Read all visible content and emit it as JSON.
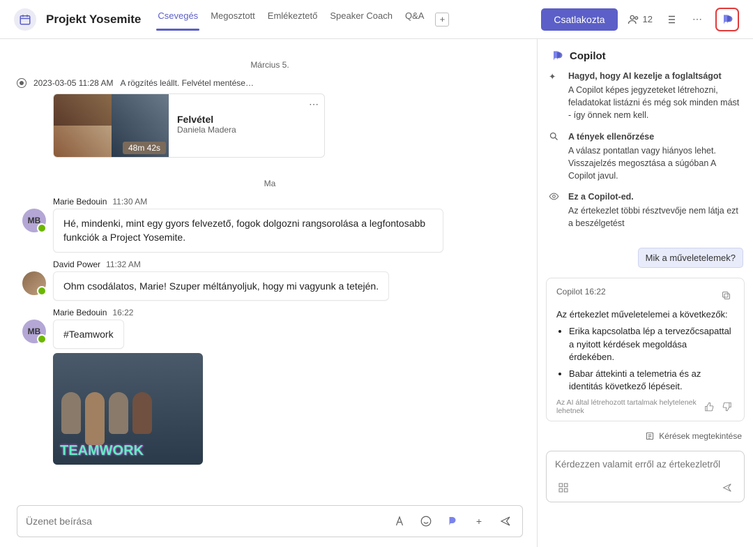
{
  "header": {
    "title": "Projekt Yosemite",
    "tabs": [
      "Csevegés",
      "Megosztott",
      "Emlékeztető",
      "Speaker Coach",
      "Q&A"
    ],
    "join": "Csatlakozta",
    "participants": "12"
  },
  "chat": {
    "date1": "Március 5.",
    "rec_time": "2023-03-05 11:28 AM",
    "rec_status": "A rögzítés leállt. Felvétel mentése…",
    "rec_title": "Felvétel",
    "rec_author": "Daniela Madera",
    "rec_duration": "48m 42s",
    "date2": "Ma",
    "m1_name": "Marie Bedouin",
    "m1_time": "11:30 AM",
    "m1_text": "Hé, mindenki, mint egy gyors felvezető, fogok dolgozni rangsorolása a legfontosabb funkciók a Project Yosemite.",
    "m2_name": "David Power",
    "m2_time": "11:32 AM",
    "m2_text": "Ohm csodálatos, Marie! Szuper méltányoljuk, hogy mi vagyunk a tetején.",
    "m3_name": "Marie Bedouin",
    "m3_time": "16:22",
    "m3_text": "#Teamwork",
    "gif_caption": "TEAMWORK",
    "compose_placeholder": "Üzenet beírása"
  },
  "copilot": {
    "title": "Copilot",
    "info1_h": "Hagyd, hogy AI kezelje a foglaltságot",
    "info1_b": "A Copilot képes jegyzeteket létrehozni, feladatokat listázni és még sok minden mást - így önnek nem kell.",
    "info2_h": "A tények ellenőrzése",
    "info2_b": "A válasz pontatlan vagy hiányos lehet. Visszajelzés megosztása a súgóban A Copilot javul.",
    "info3_h": "Ez a Copilot-ed.",
    "info3_b": "Az értekezlet többi résztvevője nem látja ezt a beszélgetést",
    "chip": "Mik a műveletelemek?",
    "reply_from": "Copilot",
    "reply_time": "16:22",
    "reply_lead": "Az értekezlet műveletelemei a következők:",
    "reply_i1": "Erika kapcsolatba lép a tervezőcsapattal a nyitott kérdések megoldása érdekében.",
    "reply_i2": "Babar áttekinti a telemetria és az identitás következő lépéseit.",
    "disclaimer": "Az AI által létrehozott tartalmak helytelenek lehetnek",
    "view_requests": "Kérések megtekintése",
    "input_placeholder": "Kérdezzen valamit erről az értekezletről"
  }
}
